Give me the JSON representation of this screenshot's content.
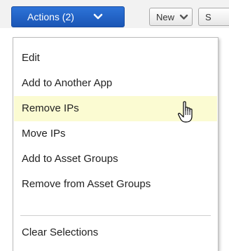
{
  "toolbar": {
    "actions_label": "Actions (2)",
    "new_label": "New",
    "clipped_label": "S"
  },
  "menu": {
    "items": [
      {
        "label": "Edit"
      },
      {
        "label": "Add to Another App"
      },
      {
        "label": "Remove IPs"
      },
      {
        "label": "Move IPs"
      },
      {
        "label": "Add to Asset Groups"
      },
      {
        "label": "Remove from Asset Groups"
      },
      {
        "label": "Clear Selections"
      }
    ],
    "hovered_item": "Remove IPs"
  },
  "colors": {
    "primary_button": "#1f60c6",
    "hover_highlight": "#fbfbd2"
  },
  "icons": {
    "chevron": "chevron-down-icon",
    "cursor": "hand-pointer-icon"
  }
}
